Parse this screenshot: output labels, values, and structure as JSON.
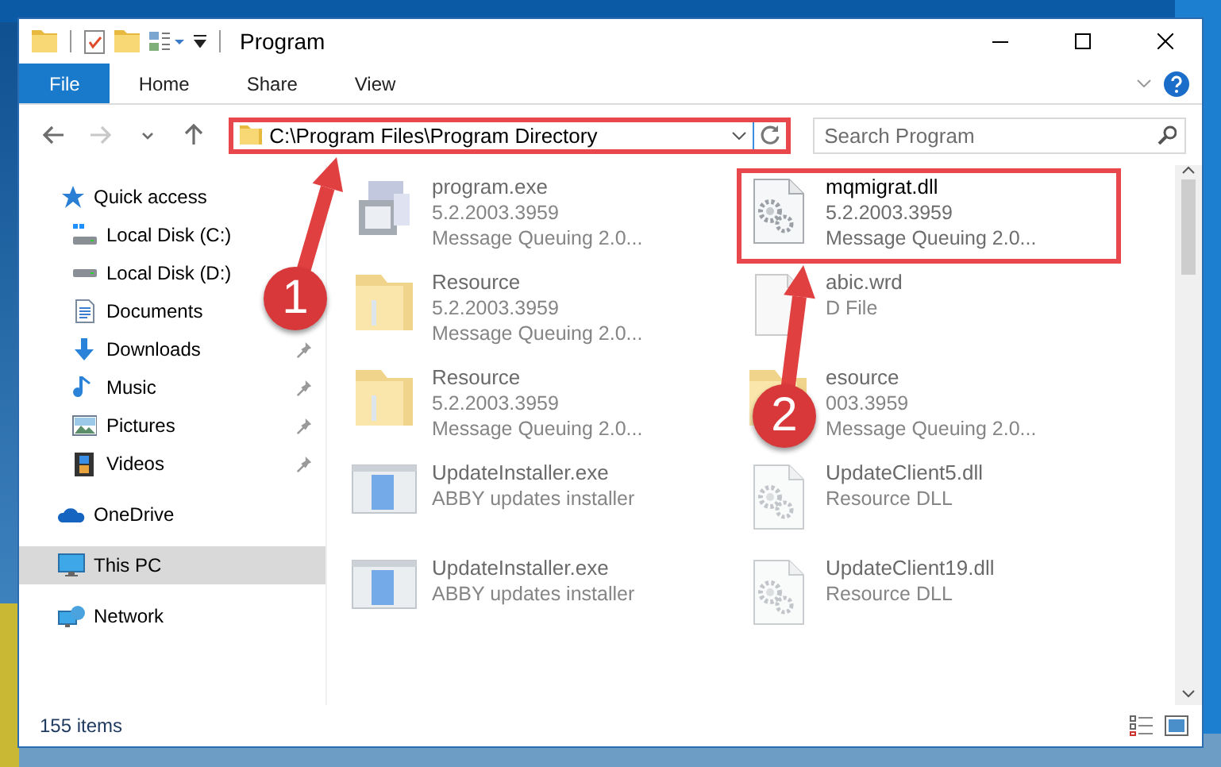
{
  "window": {
    "title": "Program"
  },
  "ribbon": {
    "tabs": [
      {
        "label": "File",
        "selected": true
      },
      {
        "label": "Home",
        "selected": false
      },
      {
        "label": "Share",
        "selected": false
      },
      {
        "label": "View",
        "selected": false
      }
    ]
  },
  "navigation": [
    {
      "kind": "back",
      "disabled": false
    },
    {
      "kind": "forward",
      "disabled": true
    },
    {
      "kind": "recent",
      "disabled": false
    },
    {
      "kind": "up",
      "disabled": false
    }
  ],
  "address_bar": {
    "path": "C:\\Program Files\\Program Directory",
    "highlighted": true
  },
  "search": {
    "placeholder": "Search Program"
  },
  "sidebar": {
    "items": [
      {
        "label": "Quick access",
        "selected": false,
        "children": [
          {
            "label": "Local Disk (C:)",
            "pinned": false,
            "selected": false
          },
          {
            "label": "Local Disk (D:)",
            "pinned": false,
            "selected": false
          },
          {
            "label": "Documents",
            "pinned": false,
            "selected": false
          },
          {
            "label": "Downloads",
            "pinned": true,
            "selected": false
          },
          {
            "label": "Music",
            "pinned": true,
            "selected": false
          },
          {
            "label": "Pictures",
            "pinned": true,
            "selected": false
          },
          {
            "label": "Videos",
            "pinned": true,
            "selected": false
          }
        ]
      },
      {
        "label": "OneDrive",
        "selected": false
      },
      {
        "label": "This PC",
        "selected": true
      },
      {
        "label": "Network",
        "selected": false
      }
    ]
  },
  "files": [
    {
      "kind": "exe",
      "name": "program.exe",
      "details": [
        "5.2.2003.3959",
        "Message Queuing 2.0..."
      ],
      "blurred": true,
      "highlighted": false
    },
    {
      "kind": "dll",
      "name": "mqmigrat.dll",
      "details": [
        "5.2.2003.3959",
        "Message Queuing 2.0..."
      ],
      "blurred": false,
      "highlighted": true
    },
    {
      "kind": "folder",
      "name": "Resource",
      "details": [
        "5.2.2003.3959",
        "Message Queuing 2.0..."
      ],
      "blurred": true,
      "highlighted": false
    },
    {
      "kind": "file",
      "name": "abic.wrd",
      "details": [
        "D File"
      ],
      "blurred": true,
      "highlighted": false
    },
    {
      "kind": "folder",
      "name": "Resource",
      "details": [
        "5.2.2003.3959",
        "Message Queuing 2.0..."
      ],
      "blurred": true,
      "highlighted": false
    },
    {
      "kind": "folder",
      "name": "esource",
      "details": [
        "003.3959",
        "Message Queuing 2.0..."
      ],
      "blurred": true,
      "highlighted": false
    },
    {
      "kind": "installer",
      "name": "UpdateInstaller.exe",
      "details": [
        "ABBY updates installer"
      ],
      "blurred": true,
      "highlighted": false
    },
    {
      "kind": "dll",
      "name": "UpdateClient5.dll",
      "details": [
        "Resource DLL"
      ],
      "blurred": true,
      "highlighted": false
    },
    {
      "kind": "installer",
      "name": "UpdateInstaller.exe",
      "details": [
        "ABBY updates installer"
      ],
      "blurred": true,
      "highlighted": false
    },
    {
      "kind": "dll",
      "name": "UpdateClient19.dll",
      "details": [
        "Resource DLL"
      ],
      "blurred": true,
      "highlighted": false
    }
  ],
  "status_bar": {
    "count": "155 items"
  },
  "annotations": [
    {
      "label": "1"
    },
    {
      "label": "2"
    }
  ]
}
